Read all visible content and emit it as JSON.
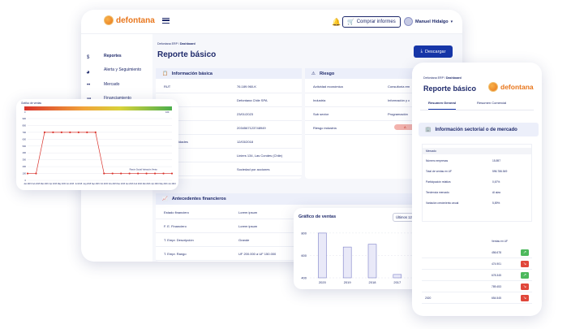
{
  "logo": {
    "word": "defontana",
    "tagline": "SOLUCIONES INTELIGENTES PARA TU EMPRESA"
  },
  "header": {
    "buy_label": "Comprar informes",
    "user_name": "Manuel Hidalgo"
  },
  "sidebar": {
    "items": [
      {
        "label": "Reportes",
        "icon": "dollar-icon"
      },
      {
        "label": "Alerta y Seguimiento",
        "icon": "bell-circle-icon"
      },
      {
        "label": "Mercado",
        "icon": "dots-icon"
      },
      {
        "label": "Financiamiento",
        "icon": "bank-icon"
      }
    ]
  },
  "page": {
    "crumb_prefix": "Defontana ERP /",
    "crumb_current": "Dashboard",
    "title": "Reporte básico",
    "download_label": "Descargar"
  },
  "info_basica": {
    "title": "Información básica",
    "rows": [
      {
        "key": "RUT",
        "value": "76.189.960-K"
      },
      {
        "key": "",
        "value": "Defontana Chile SPA"
      },
      {
        "key": "",
        "value": "23/01/2023"
      },
      {
        "key": "",
        "value": "2034567123748949"
      },
      {
        "key": "io de actividades",
        "value": "12/03/2018"
      },
      {
        "key": "",
        "value": "Liniers 134, Las Condes (Chile)"
      },
      {
        "key": "ociedad",
        "value": "Sociedad por acciones"
      }
    ]
  },
  "riesgo": {
    "title": "Riesgo",
    "rows": [
      {
        "key": "Actividad económica",
        "value": "Consultoría em"
      },
      {
        "key": "Industria",
        "value": "Información y c"
      },
      {
        "key": "Sub sector",
        "value": "Programación"
      },
      {
        "key": "Riesgo industria",
        "value": "A"
      }
    ]
  },
  "antecedentes": {
    "title": "Antecedentes financieros",
    "rows": [
      {
        "key": "Estado financiero",
        "value": "Lorem ipsum"
      },
      {
        "key": "F. E. Financiero",
        "value": "Lorem ipsum"
      },
      {
        "key": "T. Empr. Descripción",
        "value": "Grande"
      },
      {
        "key": "T. Empr. Rango",
        "value": "UF 200.000 a UF 150.000"
      }
    ]
  },
  "left_chart": {
    "title": "Gráfico de ventas",
    "gradient_scale_left": "0",
    "gradient_scale_right": "100",
    "annotation": "Razón Social Variación Venta",
    "colors": {
      "line": "#d9322b",
      "point_fill": "#d9322b"
    }
  },
  "ventas_card": {
    "title": "Gráfico de ventas",
    "select_value": "Últimos 12 meses"
  },
  "phone": {
    "crumb_prefix": "Defontana ERP /",
    "crumb_current": "Dashboard",
    "title": "Reporte básico",
    "tabs": [
      "Resumen General",
      "Resumen Comercial"
    ],
    "section_title": "Información sectorial o de mercado",
    "market_header": "Mercado",
    "market_rows": [
      {
        "key": "Número empresas",
        "value": "15.897"
      },
      {
        "key": "Total de ventas en UF",
        "value": "596.786.549"
      },
      {
        "key": "Participación relativa",
        "value": "0,67%"
      },
      {
        "key": "Tendencia mercado",
        "value": "Al alza"
      },
      {
        "key": "Variación crecimiento anual",
        "value": "5,89%"
      }
    ],
    "ventas_header": "Ventas en UF",
    "ventas_rows": [
      {
        "year": "",
        "value": "456.678",
        "trend": "up"
      },
      {
        "year": "",
        "value": "474.901",
        "trend": "down"
      },
      {
        "year": "",
        "value": "678.345",
        "trend": "up"
      },
      {
        "year": "",
        "value": "789.453",
        "trend": "down"
      },
      {
        "year": "2020",
        "value": "654.545",
        "trend": "down"
      }
    ]
  },
  "chart_data": [
    {
      "type": "line",
      "title": "Gráfico de ventas",
      "x": [
        "Jan 2015",
        "Feb 2015",
        "Mar 2015",
        "Apr 2015",
        "May 2015",
        "Jun 2015",
        "Jul 2015",
        "Aug 2015",
        "Sep 2015",
        "Oct 2015",
        "Nov 2015",
        "Dec 2015",
        "Jan 2016",
        "Feb 2016",
        "Mar 2016",
        "Apr 2016",
        "May 2016",
        "Jun 2016"
      ],
      "y_ticks": [
        "900",
        "800",
        "700",
        "600",
        "500",
        "400",
        "300",
        "200",
        "100",
        "0"
      ],
      "ylim": [
        0,
        900
      ],
      "values": [
        100,
        100,
        700,
        700,
        700,
        700,
        700,
        700,
        700,
        100,
        100,
        100,
        100,
        100,
        100,
        100,
        100,
        100
      ],
      "grid": true
    },
    {
      "type": "bar",
      "title": "Gráfico de ventas",
      "categories": [
        "2020",
        "2019",
        "2018",
        "2017",
        "2016"
      ],
      "values": [
        800,
        675,
        700,
        430,
        500
      ],
      "y_ticks": [
        "800",
        "600",
        "400"
      ],
      "ylim": [
        400,
        850
      ],
      "grid": true
    }
  ]
}
